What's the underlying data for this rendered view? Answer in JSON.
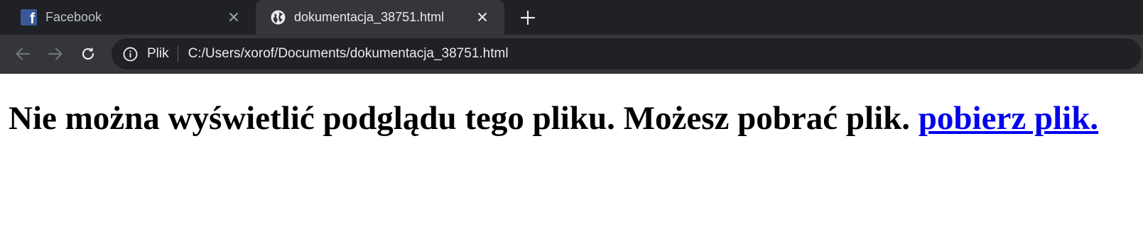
{
  "browser": {
    "tabs": [
      {
        "label": "Facebook",
        "icon": "facebook-icon",
        "active": false
      },
      {
        "label": "dokumentacja_38751.html",
        "icon": "globe-icon",
        "active": true
      }
    ],
    "new_tab_icon": "plus-icon",
    "toolbar": {
      "back_icon": "back-arrow-icon",
      "forward_icon": "forward-arrow-icon",
      "reload_icon": "reload-icon"
    },
    "address_bar": {
      "security_icon": "info-icon",
      "security_chip_label": "Plik",
      "url": "C:/Users/xorof/Documents/dokumentacja_38751.html"
    }
  },
  "page": {
    "message": "Nie można wyświetlić podglądu tego pliku. Możesz pobrać plik.",
    "download_link_label": " pobierz plik."
  },
  "colors": {
    "tab_strip": "#202124",
    "active_tab": "#35363a",
    "omnibox": "#202124",
    "link": "#0000ee",
    "facebook_blue": "#3b5998"
  }
}
